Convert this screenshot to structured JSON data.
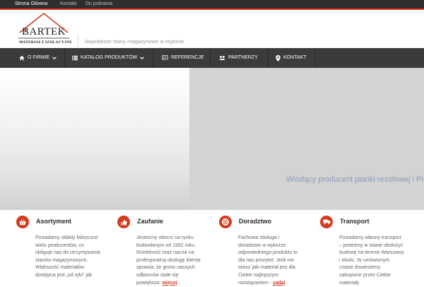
{
  "topbar": {
    "links": [
      "Strona Główna",
      "Kontakt",
      "Do pobrania"
    ]
  },
  "header": {
    "logo_text": "BARTEK",
    "logo_subtitle": "MATERIAŁY IZOLACYJNE",
    "tagline": "Największe stany magazynowe w regionie"
  },
  "nav": {
    "items": [
      {
        "label": "O FIRMIE",
        "icon": "home-icon"
      },
      {
        "label": "KATALOG PRODUKTÓW",
        "icon": "list-icon"
      },
      {
        "label": "REFERENCJE",
        "icon": "comment-icon"
      },
      {
        "label": "PARTNERZY",
        "icon": "handshake-icon"
      },
      {
        "label": "KONTAKT",
        "icon": "location-pin-icon"
      }
    ]
  },
  "slider": {
    "caption": "Wiodący producent pianki rezolowej i PIR"
  },
  "features": [
    {
      "title": "Asortyment",
      "icon": "basket-icon",
      "text": "Posiadamy składy fabryczne wielu producentów, co obliguje nas do utrzymywania stanów magazynowych. Większość materiałów dostępna jest „od ręki\" jak",
      "more": ""
    },
    {
      "title": "Zaufanie",
      "icon": "thumbs-up-icon",
      "text": "Jesteśmy obecni na rynku budowlanym od 1992 roku. Rzetelność oraz nacisk na profesjonalną obsługę klienta sprawia, że grono naszych odbiorców stale się powiększa. ",
      "more": "więcej"
    },
    {
      "title": "Doradztwo",
      "icon": "lifebuoy-icon",
      "text": "Fachowa obsługa i doradztwo w wyborze odpowiedniego produktu to dla nas priorytet. Jeśli nie wiesz jaki materiał jest dla Ciebie najlepszym rozwiązaniem - ",
      "more": "zadaj"
    },
    {
      "title": "Transport",
      "icon": "truck-icon",
      "text": "Posiadamy własny transport – jesteśmy w stanie obsłużyć budowę na terenie Warszawy i okolic. W umówionym czasie dowieziemy zakupione przez Ciebie materiały",
      "more": ""
    }
  ],
  "colors": {
    "accent": "#d63a1f",
    "nav_bg": "#3b3b3b",
    "topbar_bg": "#2e2e2e"
  }
}
